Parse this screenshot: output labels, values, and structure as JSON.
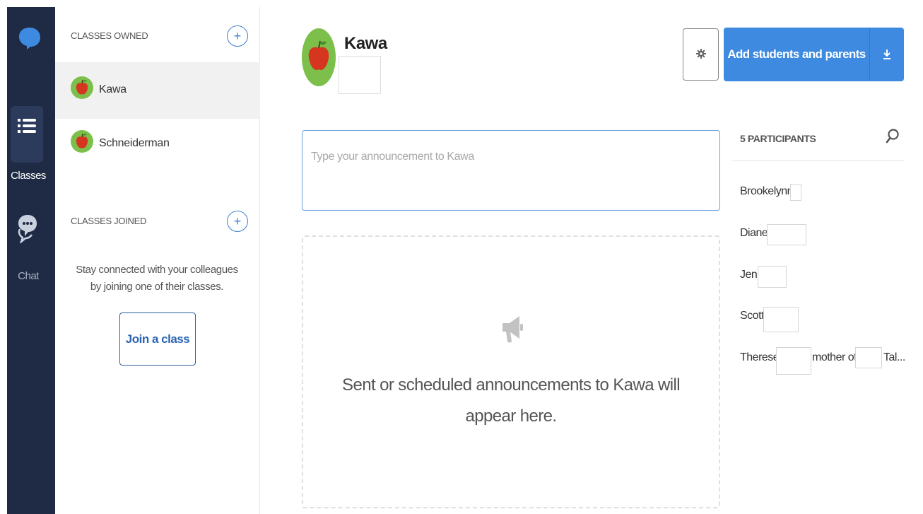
{
  "nav": {
    "items": [
      {
        "label": "Classes",
        "icon": "list-icon",
        "active": true
      },
      {
        "label": "Chat",
        "icon": "chat-bubble-icon",
        "active": false
      }
    ],
    "colors": {
      "rail": "#1f2a44",
      "active": "#2c3a5c"
    }
  },
  "sidebar": {
    "owned_title": "CLASSES OWNED",
    "owned": [
      {
        "name": "Kawa",
        "active": true
      },
      {
        "name": "Schneiderman",
        "active": false
      }
    ],
    "joined_title": "CLASSES JOINED",
    "joined_text": "Stay connected with your colleagues by joining one of their classes.",
    "join_button": "Join a class",
    "add_symbol": "+"
  },
  "header": {
    "title": "Kawa",
    "add_button": "Add students and parents",
    "accent": "#3d8ae0"
  },
  "announcement": {
    "placeholder": "Type your announcement to Kawa",
    "empty_text": "Sent or scheduled announcements to Kawa will appear here."
  },
  "participants": {
    "title": "5 PARTICIPANTS",
    "people": [
      {
        "name": "Brookelynn"
      },
      {
        "name": "Diane"
      },
      {
        "name": "Jen"
      },
      {
        "name": "Scott"
      },
      {
        "name": "Therese",
        "relation": "mother of",
        "child": "Tal..."
      }
    ]
  }
}
